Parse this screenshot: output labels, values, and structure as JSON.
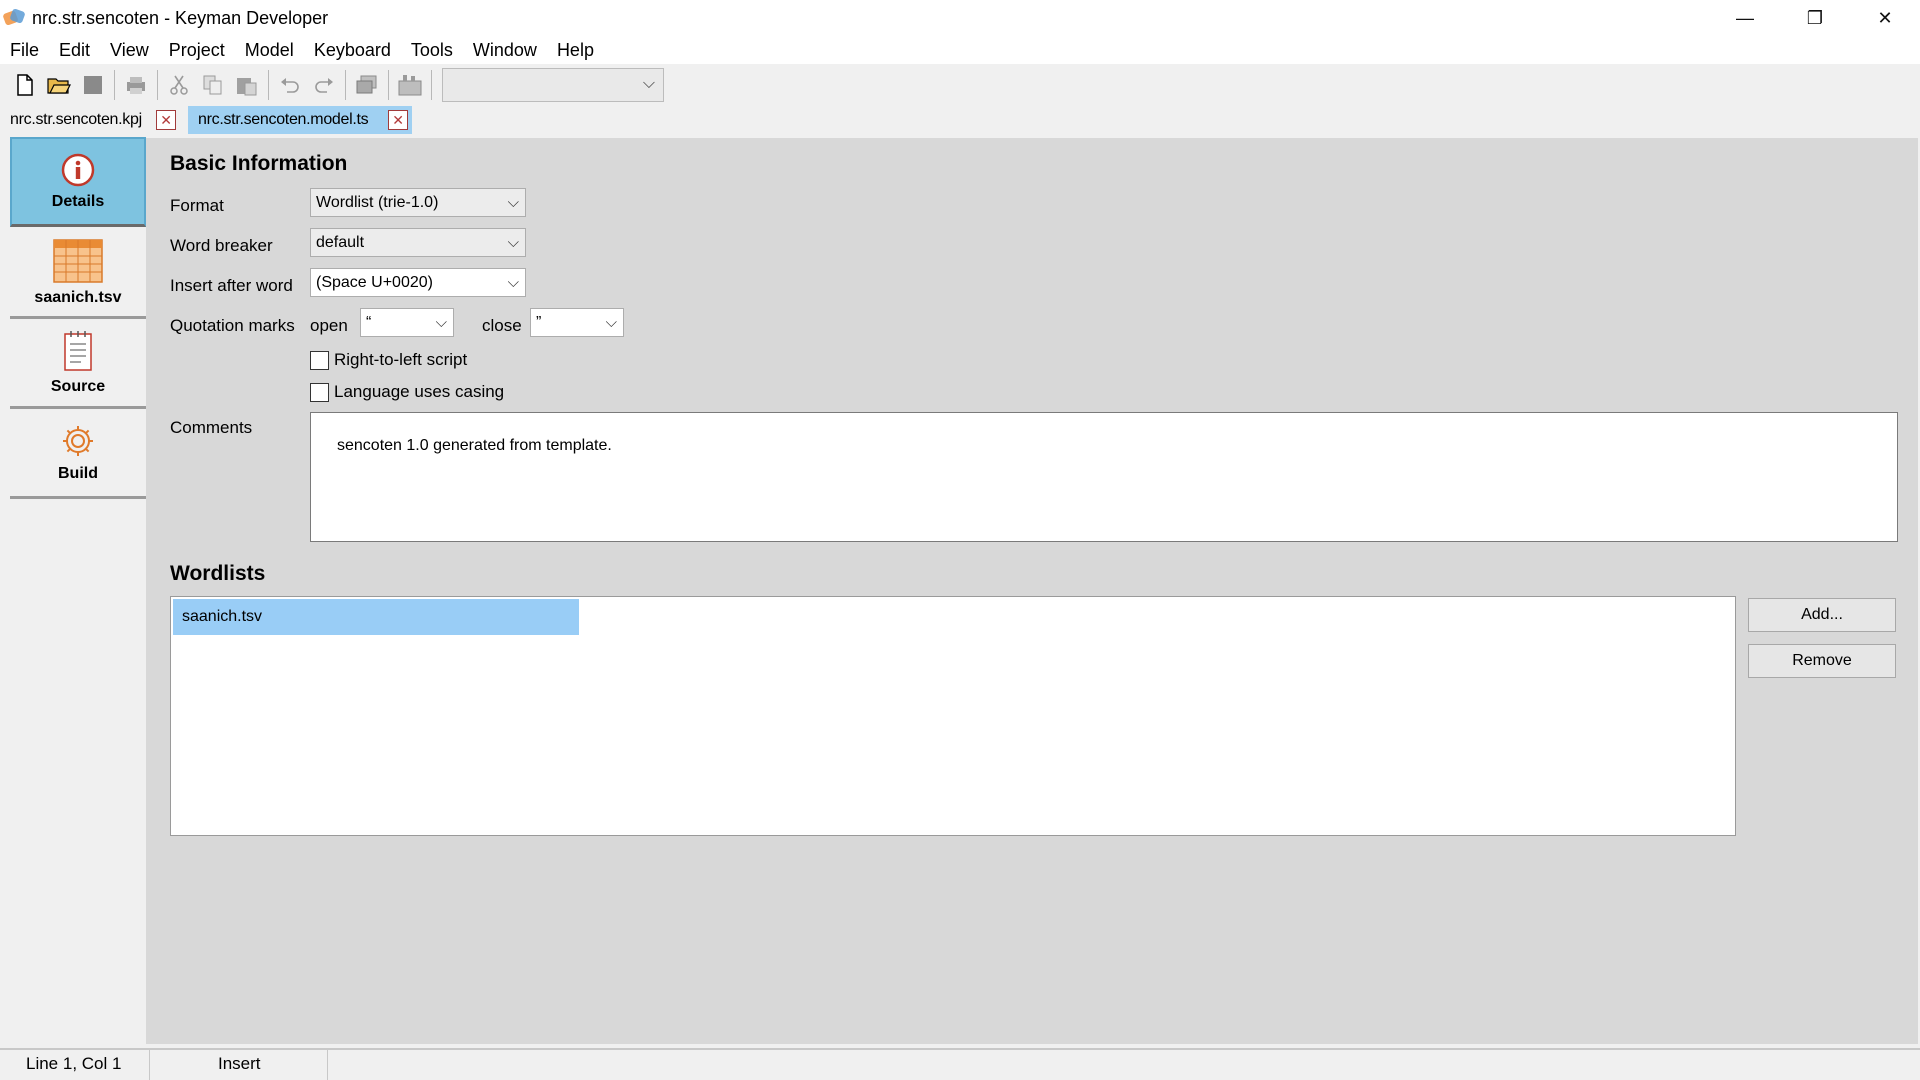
{
  "window": {
    "title": "nrc.str.sencoten - Keyman Developer",
    "minimize": "—",
    "maximize": "❐",
    "close": "✕"
  },
  "menu": [
    "File",
    "Edit",
    "View",
    "Project",
    "Model",
    "Keyboard",
    "Tools",
    "Window",
    "Help"
  ],
  "toolbar": {
    "icons": [
      "new-file-icon",
      "open-folder-icon",
      "save-icon",
      "print-icon",
      "cut-icon",
      "copy-icon",
      "paste-icon",
      "undo-icon",
      "redo-icon",
      "window-icon",
      "build-icon"
    ],
    "combo_value": ""
  },
  "tabs": [
    {
      "label": "nrc.str.sencoten.kpj",
      "active": false
    },
    {
      "label": "nrc.str.sencoten.model.ts",
      "active": true
    }
  ],
  "sidebar": {
    "items": [
      {
        "label": "Details",
        "icon": "info-icon",
        "active": true
      },
      {
        "label": "saanich.tsv",
        "icon": "table-icon",
        "active": false
      },
      {
        "label": "Source",
        "icon": "document-icon",
        "active": false
      },
      {
        "label": "Build",
        "icon": "gear-icon",
        "active": false
      }
    ]
  },
  "basic_info": {
    "title": "Basic Information",
    "format_label": "Format",
    "format_value": "Wordlist (trie-1.0)",
    "word_breaker_label": "Word breaker",
    "word_breaker_value": "default",
    "insert_after_label": "Insert after word",
    "insert_after_value": "(Space U+0020)",
    "quotation_label": "Quotation marks",
    "open_label": "open",
    "open_value": "“",
    "close_label": "close",
    "close_value": "”",
    "rtl_label": "Right-to-left script",
    "rtl_checked": false,
    "casing_label": "Language uses casing",
    "casing_checked": false,
    "comments_label": "Comments",
    "comments_value": "sencoten 1.0 generated from template."
  },
  "wordlists": {
    "title": "Wordlists",
    "items": [
      "saanich.tsv"
    ],
    "add_label": "Add...",
    "remove_label": "Remove"
  },
  "status": {
    "position": "Line 1, Col 1",
    "mode": "Insert"
  }
}
